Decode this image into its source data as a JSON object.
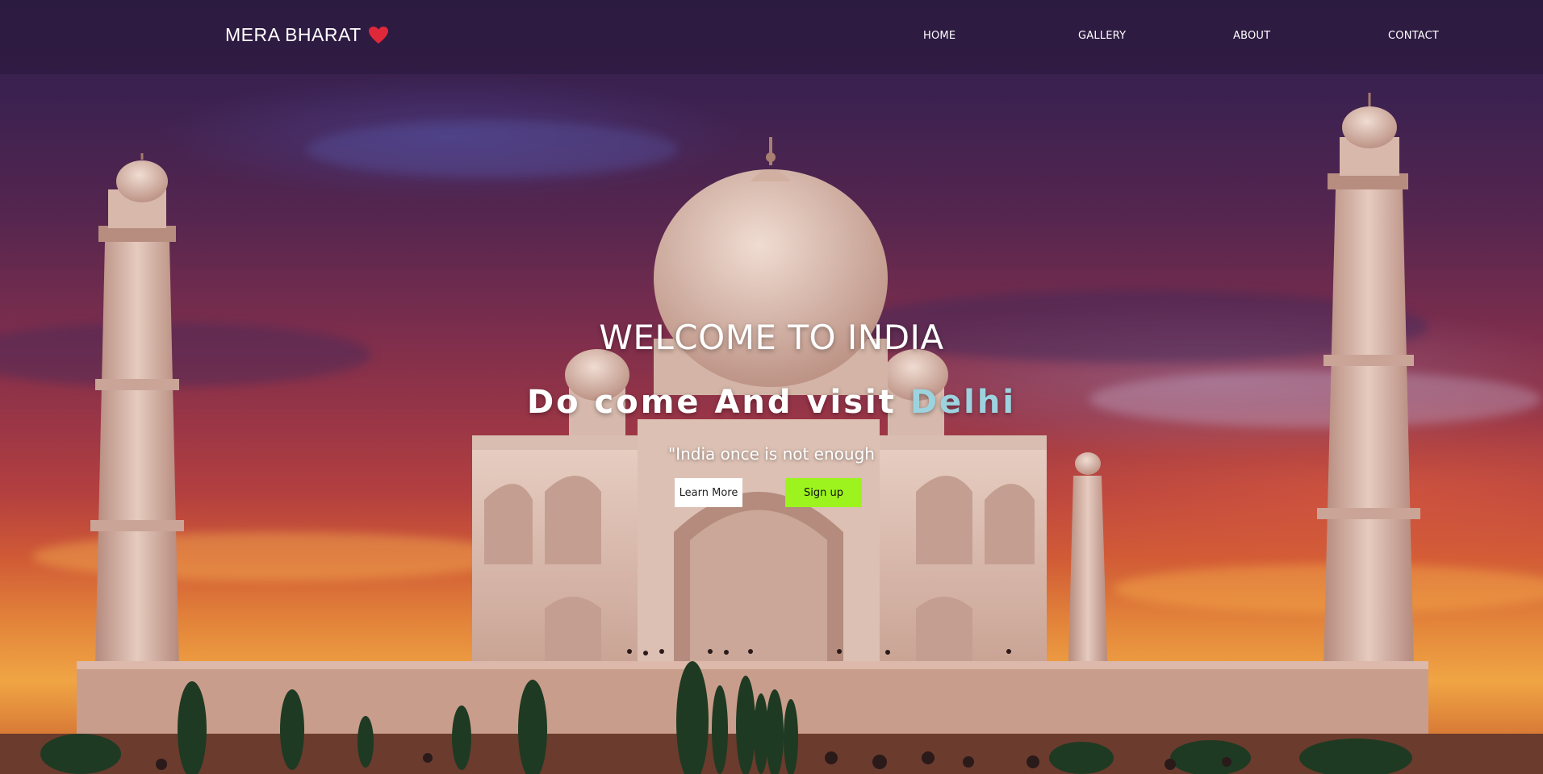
{
  "brand": {
    "name": "MERA BHARAT",
    "icon": "heart-icon",
    "icon_color": "#e0283b"
  },
  "nav": {
    "items": [
      {
        "label": "HOME"
      },
      {
        "label": "GALLERY"
      },
      {
        "label": "ABOUT"
      },
      {
        "label": "CONTACT"
      }
    ]
  },
  "hero": {
    "title": "WELCOME TO INDIA",
    "subtitle_prefix": "Do come And visit",
    "subtitle_city": "Delhi",
    "city_color": "#9cd3df",
    "quote": "\"India once is not enough",
    "buttons": {
      "learn_more": "Learn More",
      "sign_up": "Sign up",
      "sign_up_color": "#9cf31d"
    }
  }
}
